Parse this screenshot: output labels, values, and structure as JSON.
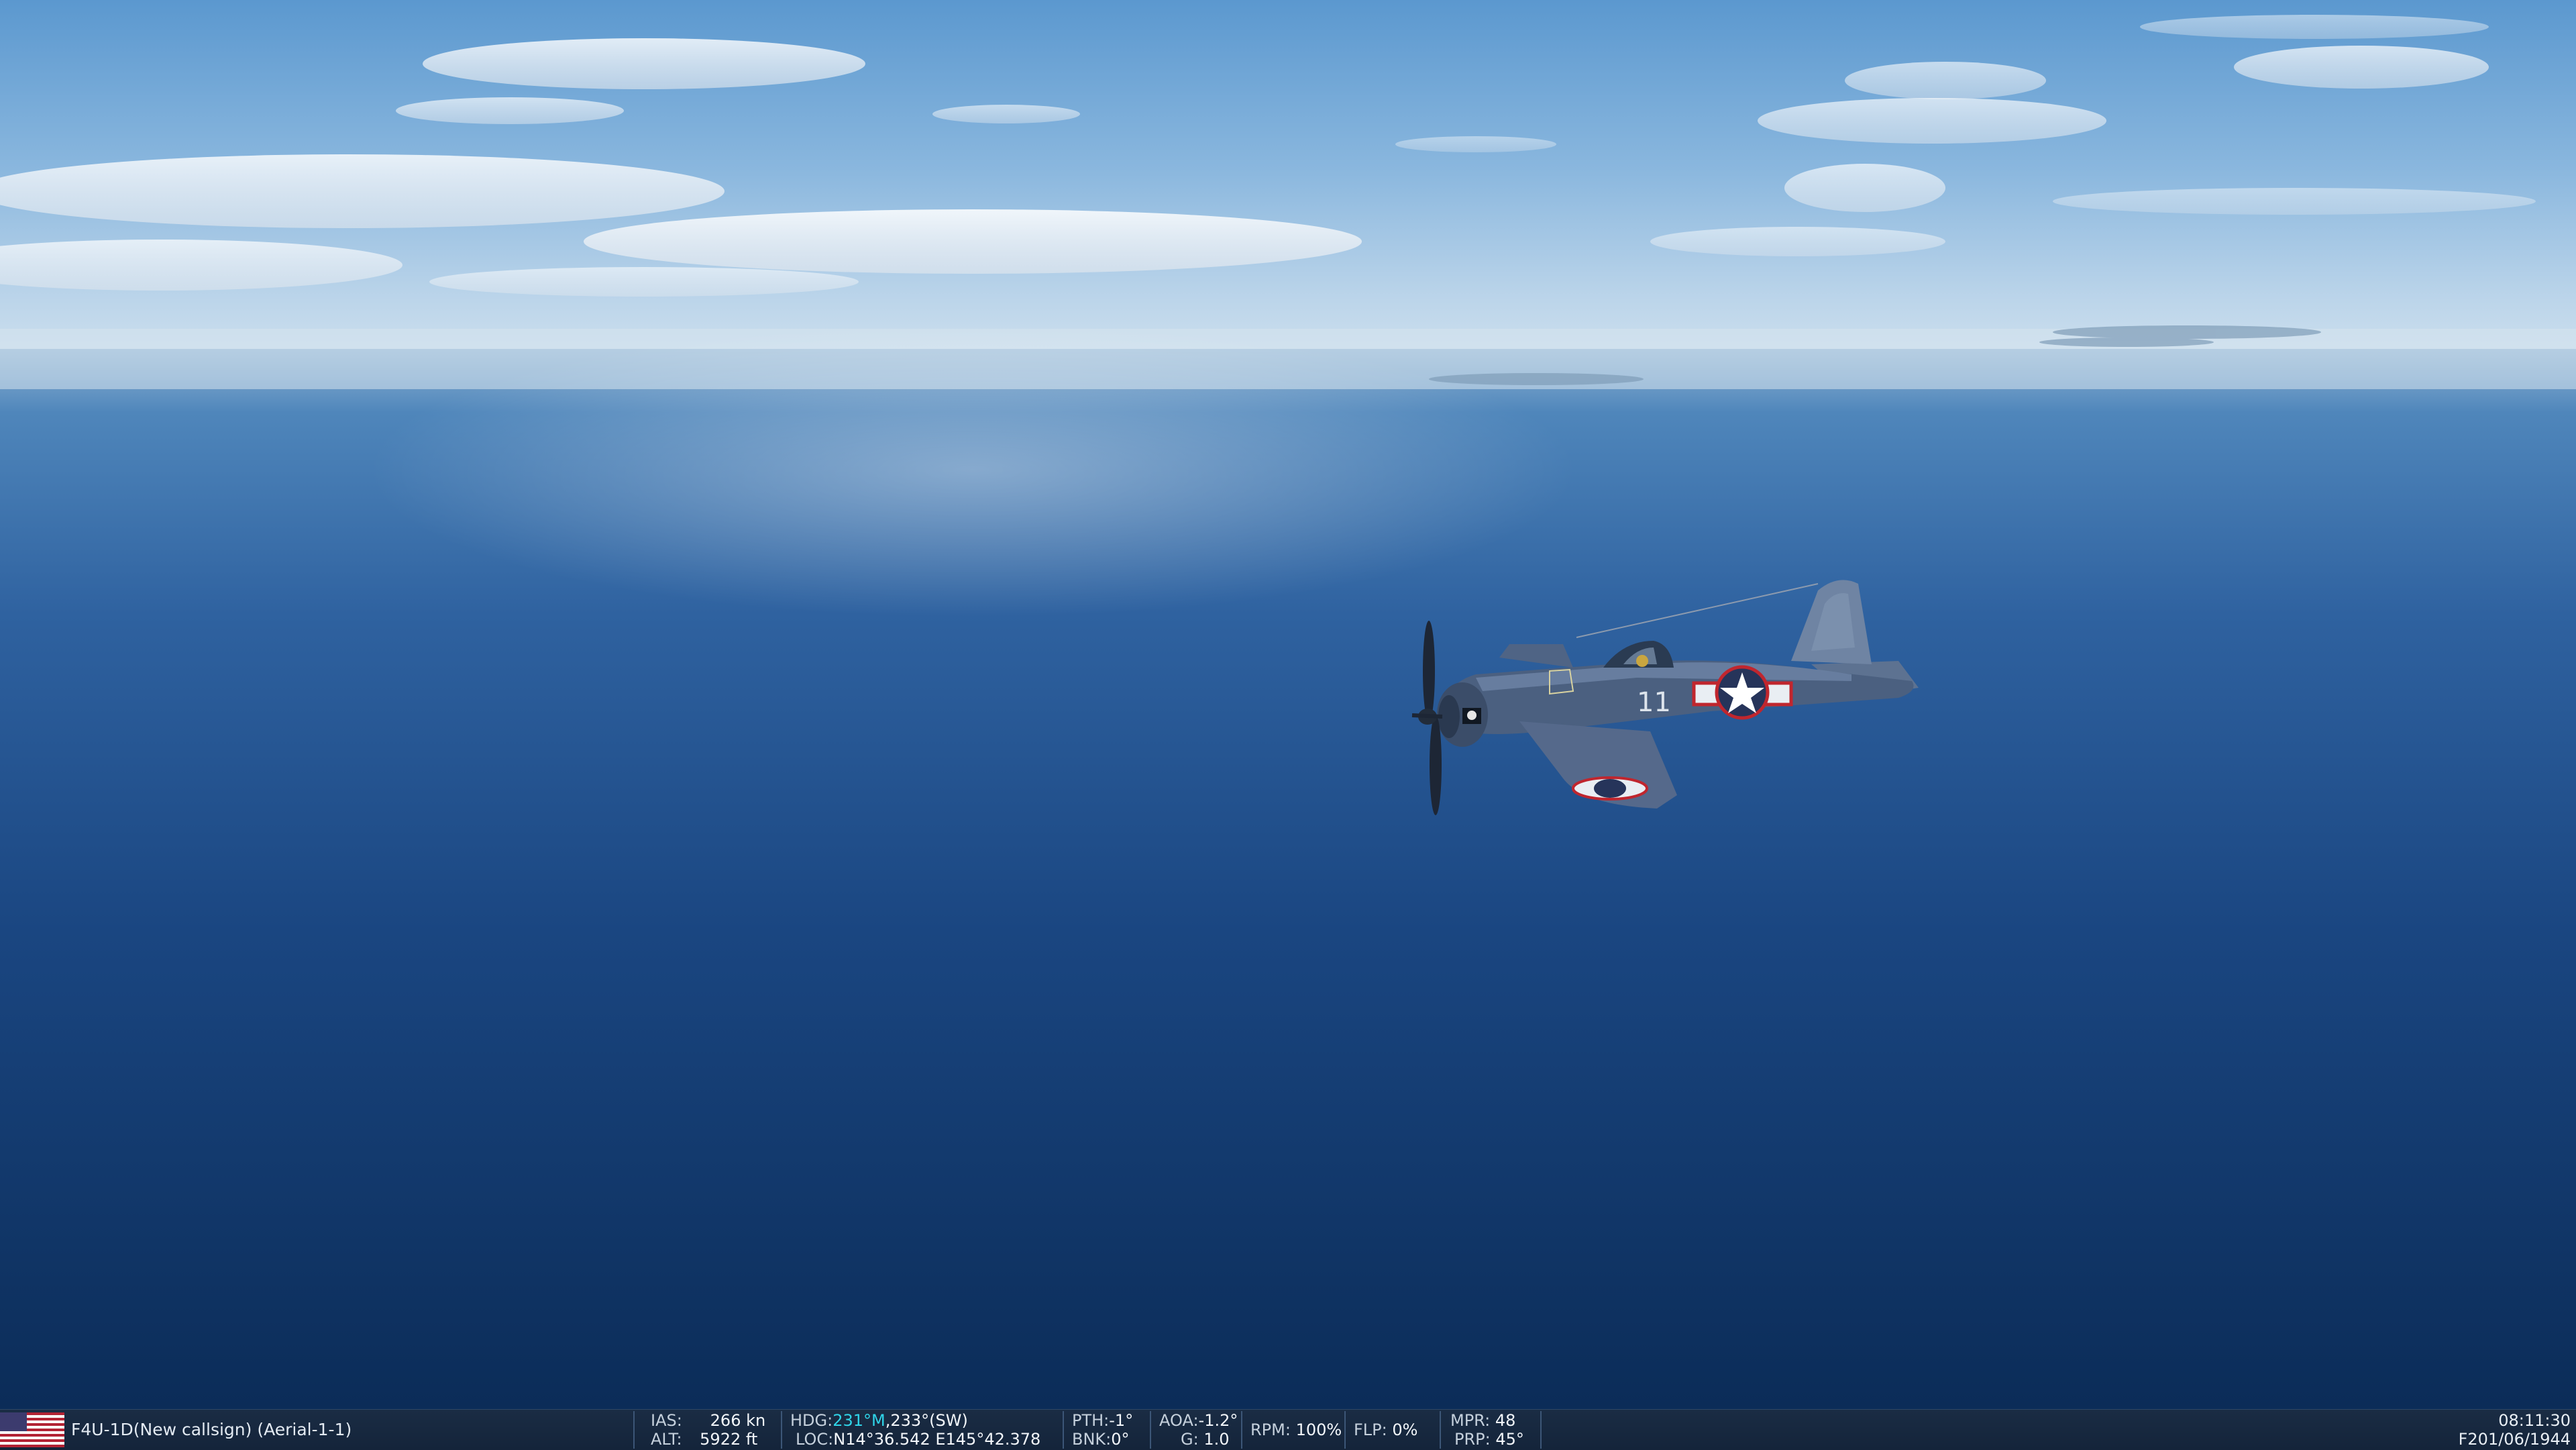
{
  "hud": {
    "flag_icon": "usa-flag-icon",
    "aircraft_label": "F4U-1D(New callsign) (Aerial-1-1)",
    "ias_label": "IAS:",
    "ias_value": "266",
    "ias_unit": "kn",
    "alt_label": "ALT:",
    "alt_value": "5922",
    "alt_unit": "ft",
    "hdg_label": "HDG:",
    "hdg_magnetic": "231°M",
    "hdg_true": "233°(SW)",
    "loc_label": "LOC:",
    "loc_value": "N14°36.542 E145°42.378",
    "pth_label": "PTH:",
    "pth_value": "-1°",
    "bnk_label": "BNK:",
    "bnk_value": "0°",
    "aoa_label": "AOA:",
    "aoa_value": "-1.2°",
    "g_label": "G:",
    "g_value": "1.0",
    "rpm_label": "RPM:",
    "rpm_value": "100%",
    "flp_label": "FLP:",
    "flp_value": "0%",
    "mpr_label": "MPR:",
    "mpr_value": "48",
    "prp_label": "PRP:",
    "prp_value": "45°",
    "time": "08:11:30",
    "date": "F201/06/1944"
  },
  "aircraft": {
    "side_number": "11"
  },
  "colors": {
    "sky_top": "#5f9bd0",
    "horizon_haze": "#c9dbe9",
    "ocean_far": "#3d74ac",
    "ocean_near": "#0b2d58",
    "aircraft_body": "#4a5d78",
    "hud_highlight": "#2fd4e8"
  }
}
